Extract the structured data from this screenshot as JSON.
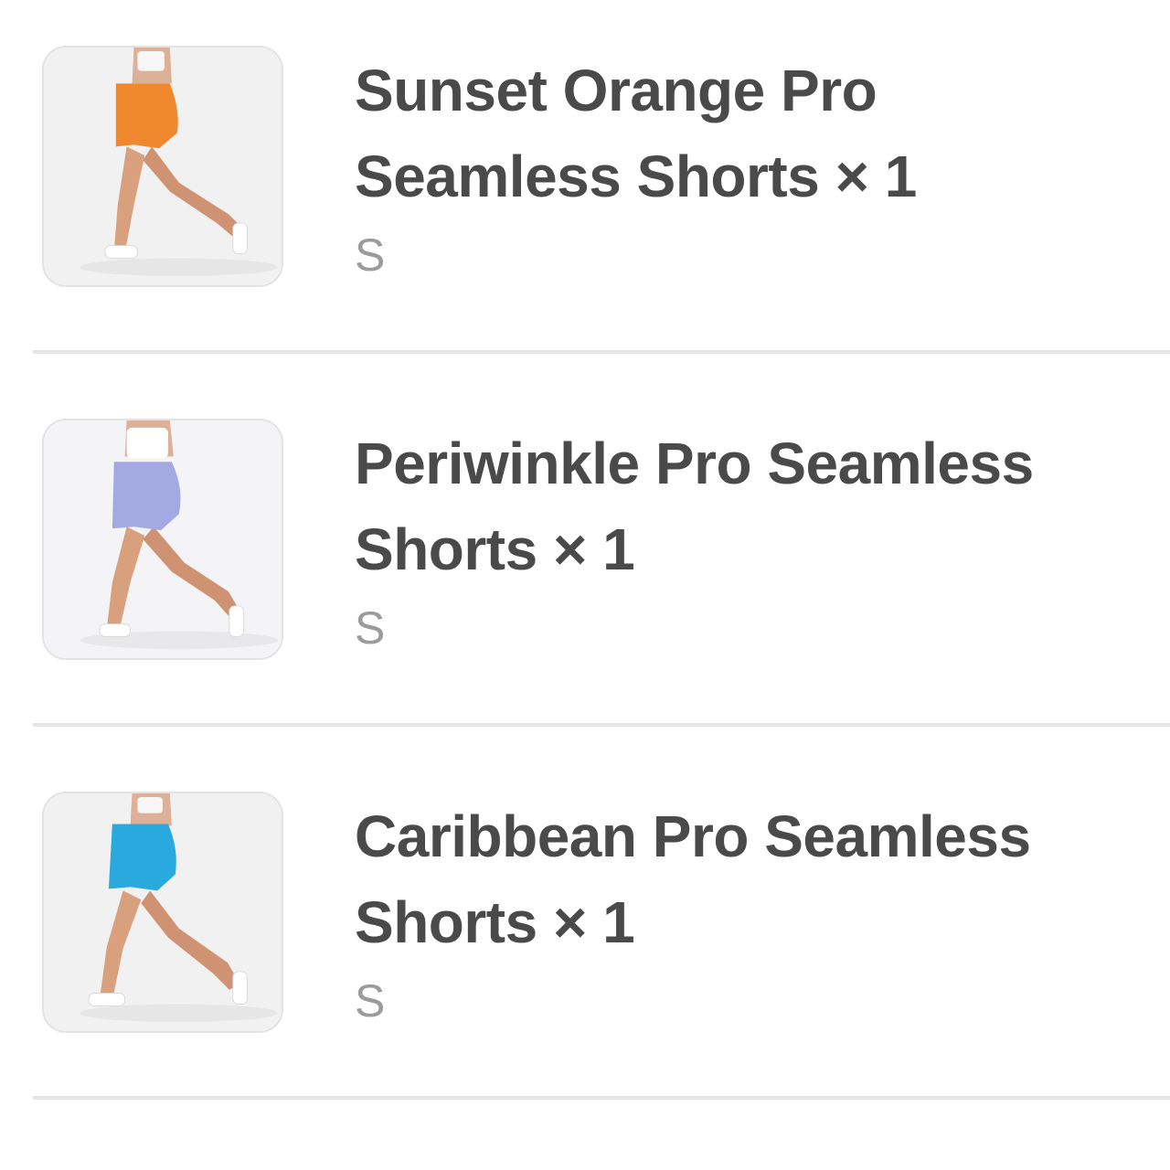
{
  "items": [
    {
      "title": "Sunset Orange Pro Seamless Shorts × 1",
      "variant": "S",
      "thumbnail": {
        "icon": "product-photo",
        "color": "#f0892d"
      }
    },
    {
      "title": "Periwinkle Pro Seamless Shorts × 1",
      "variant": "S",
      "thumbnail": {
        "icon": "product-photo",
        "color": "#a2a9e3"
      }
    },
    {
      "title": "Caribbean Pro Seamless Shorts × 1",
      "variant": "S",
      "thumbnail": {
        "icon": "product-photo",
        "color": "#2aa9df"
      }
    }
  ]
}
